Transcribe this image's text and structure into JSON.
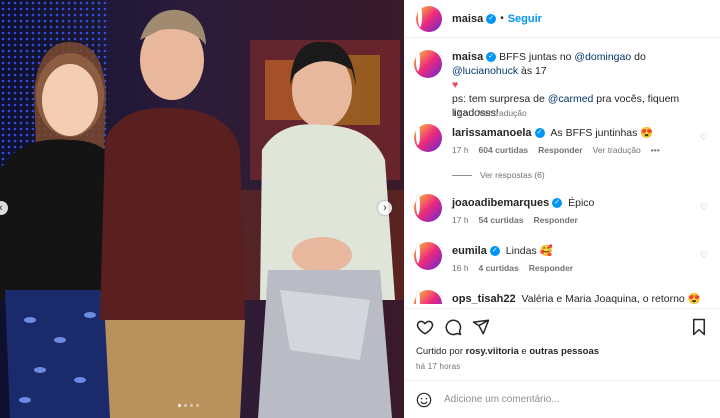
{
  "post": {
    "username": "maisa",
    "follow_label": "Seguir",
    "separator": "•"
  },
  "caption": {
    "username": "maisa",
    "text_1": "BFFS juntas no ",
    "mention_1": "@domingao",
    "text_2": " do ",
    "mention_2": "@lucianohuck",
    "text_3": " às 17",
    "heart": "♥",
    "text_4": "ps: tem surpresa de ",
    "mention_3": "@carmed",
    "text_5": " pra vocês, fiquem ligadosss!",
    "time": "17 h",
    "translate": "Ver tradução"
  },
  "comments": [
    {
      "user": "larissamanoela",
      "text": "As BFFS juntinhas 😍",
      "time": "17 h",
      "likes": "604 curtidas",
      "reply": "Responder",
      "translate": "Ver tradução",
      "more": "•••"
    },
    {
      "user": "joaoadibemarques",
      "text": "Épico",
      "time": "17 h",
      "likes": "54 curtidas",
      "reply": "Responder"
    },
    {
      "user": "eumila",
      "text": "Lindas 🥰",
      "time": "16 h",
      "likes": "4 curtidas",
      "reply": "Responder"
    },
    {
      "user": "ops_tisah22",
      "text": "Valéria e Maria Joaquina, o retorno 😍"
    }
  ],
  "view_replies": "Ver respostas (6)",
  "likes_text": {
    "prefix": "Curtido por ",
    "user": "rosy.viitoria",
    "middle": " e ",
    "others": "outras pessoas"
  },
  "timestamp": "há 17 horas",
  "add_comment_placeholder": "Adicione um comentário...",
  "colors": {
    "accent": "#0095f6",
    "link": "#00376b"
  }
}
